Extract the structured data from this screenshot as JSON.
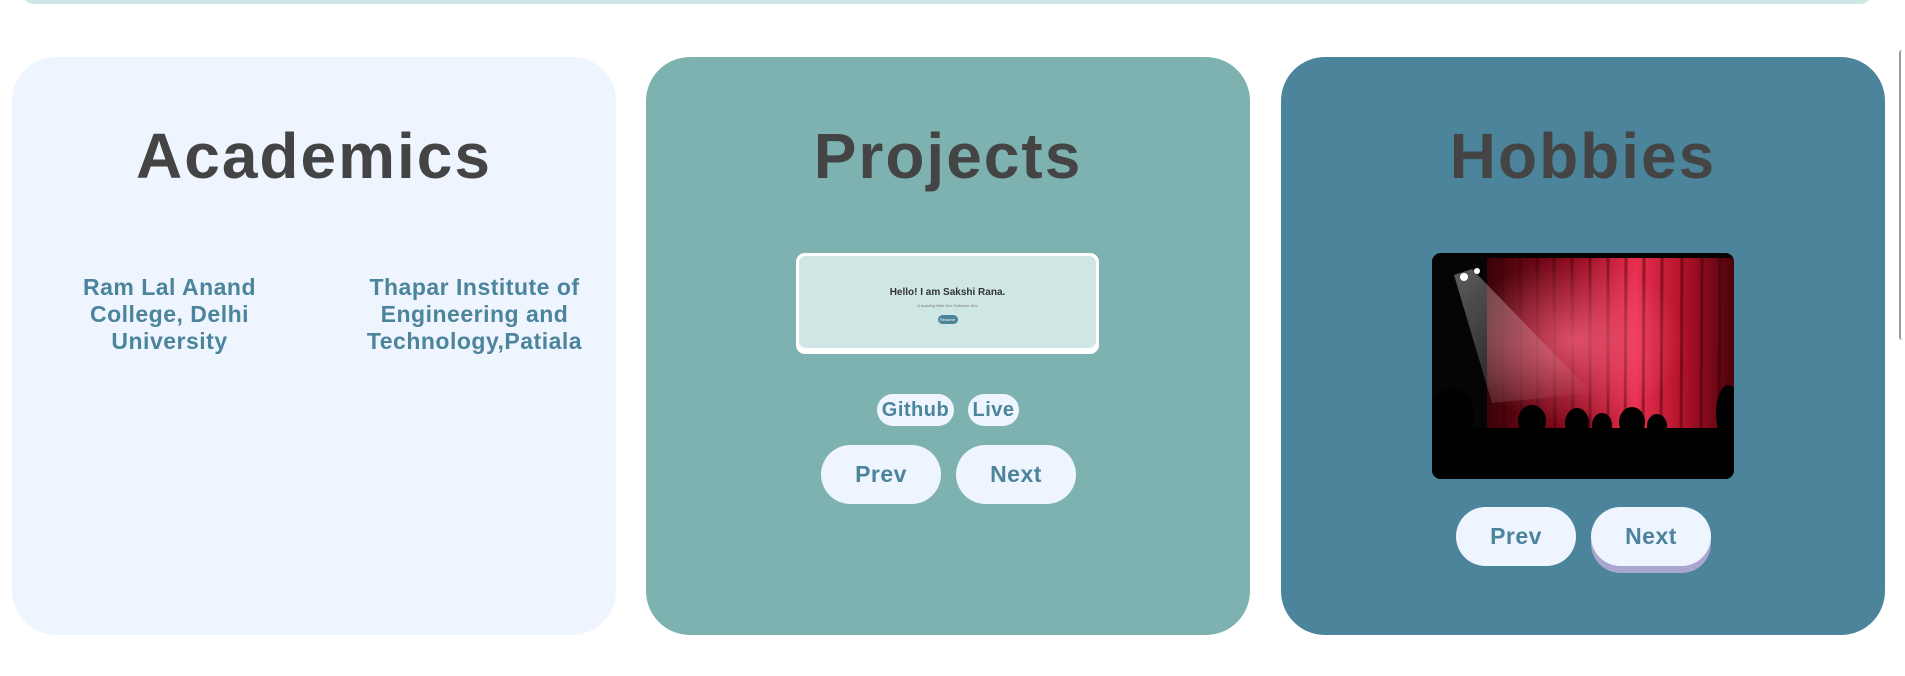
{
  "cards": {
    "academics": {
      "title": "Academics",
      "colleges": [
        "Ram Lal Anand College, Delhi University",
        "Thapar Institute of Engineering and Technology,Patiala"
      ]
    },
    "projects": {
      "title": "Projects",
      "preview": {
        "heading": "Hello! I am Sakshi Rana.",
        "subtitle": "A budding Web Dev Fullstack Dev",
        "button": "Resume"
      },
      "links": {
        "github": "Github",
        "live": "Live"
      },
      "prev": "Prev",
      "next": "Next"
    },
    "hobbies": {
      "title": "Hobbies",
      "image": "theatre-stage-red-curtain",
      "prev": "Prev",
      "next": "Next"
    }
  },
  "colors": {
    "academics_bg": "#eef5ff",
    "projects_bg": "#7db2b1",
    "hobbies_bg": "#4b849b",
    "title_text": "#444444",
    "accent_text": "#4b849b"
  }
}
